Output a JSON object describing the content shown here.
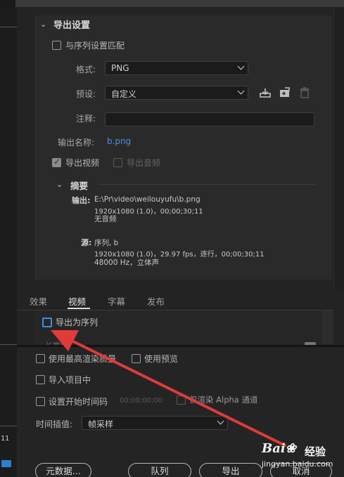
{
  "export_settings": {
    "section_title": "导出设置",
    "match_sequence_label": "与序列设置匹配",
    "format_label": "格式:",
    "format_value": "PNG",
    "preset_label": "预设:",
    "preset_value": "自定义",
    "comments_label": "注释:",
    "comments_value": "",
    "output_name_label": "输出名称:",
    "output_name_value": "b.png",
    "export_video_label": "导出视频",
    "export_video_checked": true,
    "export_audio_label": "导出音频",
    "export_audio_checked": false
  },
  "summary": {
    "title": "摘要",
    "output_label": "输出:",
    "output_path": "E:\\Pr\\video\\weilouyufu\\b.png",
    "output_spec": "1920x1080 (1.0)，00;00;30;11",
    "output_audio": "无音频",
    "source_label": "源:",
    "source_name": "序列, b",
    "source_spec": "1920x1080 (1.0)，29.97 fps，逐行，00;00;30;11",
    "source_audio": "48000 Hz，立体声"
  },
  "tabs": [
    {
      "label": "效果",
      "active": false
    },
    {
      "label": "视频",
      "active": true
    },
    {
      "label": "字幕",
      "active": false
    },
    {
      "label": "发布",
      "active": false
    }
  ],
  "video_panel": {
    "export_as_sequence_label": "导出为序列",
    "export_as_sequence_checked": false,
    "partial_row_text": "长宽比"
  },
  "bottom": {
    "max_render_quality_label": "使用最高渲染质量",
    "use_previews_label": "使用预览",
    "import_into_project_label": "导入项目中",
    "set_start_timecode_label": "设置开始时间码",
    "start_timecode_value": "00;00;00;00",
    "render_alpha_only_label": "仅渲染 Alpha 通道",
    "time_interpolation_label": "时间插值:",
    "time_interpolation_value": "帧采样",
    "metadata_button": "元数据...",
    "queue_button": "队列",
    "export_button": "导出",
    "cancel_button": "取消"
  },
  "left_edge": {
    "number_text": "11"
  },
  "watermark": {
    "logo": "Bai",
    "text": "经验",
    "url": "jingyan.baidu.com"
  },
  "colors": {
    "accent_blue": "#3b8de6",
    "link_blue": "#4a8fe0",
    "arrow_red": "#e03a3a"
  }
}
